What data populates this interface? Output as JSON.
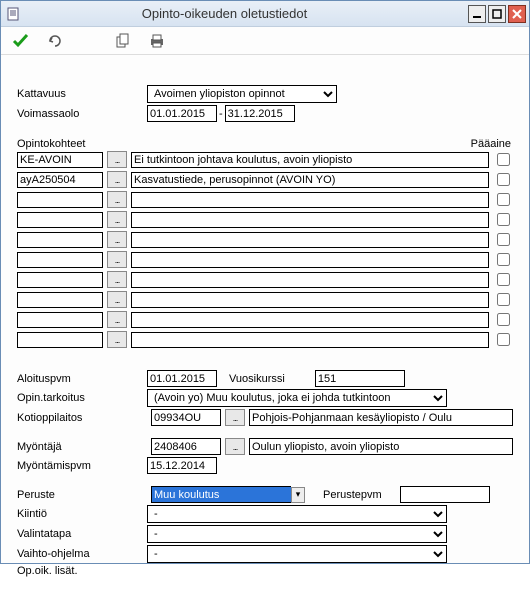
{
  "window": {
    "title": "Opinto-oikeuden oletustiedot"
  },
  "labels": {
    "kattavuus": "Kattavuus",
    "voimassaolo": "Voimassaolo",
    "opintokohteet": "Opintokohteet",
    "paaaine": "Pääaine",
    "aloituspvm": "Aloituspvm",
    "vuosikurssi": "Vuosikurssi",
    "opin_tarkoitus": "Opin.tarkoitus",
    "kotioppilaitos": "Kotioppilaitos",
    "myontaja": "Myöntäjä",
    "myontamispvm": "Myöntämispvm",
    "peruste": "Peruste",
    "perustepvm": "Perustepvm",
    "kiintio": "Kiintiö",
    "valintatapa": "Valintatapa",
    "vaihto_ohjelma": "Vaihto-ohjelma",
    "op_oik_lisat": "Op.oik. lisät."
  },
  "values": {
    "kattavuus": "Avoimen yliopiston opinnot",
    "voimassa_alku": "01.01.2015",
    "voimassa_loppu": "31.12.2015",
    "aloituspvm": "01.01.2015",
    "vuosikurssi": "151",
    "opin_tarkoitus": "(Avoin yo) Muu koulutus, joka ei johda tutkintoon",
    "kotioppilaitos_code": "09934OU",
    "kotioppilaitos_name": "Pohjois-Pohjanmaan kesäyliopisto / Oulu",
    "myontaja_code": "2408406",
    "myontaja_name": "Oulun yliopisto, avoin yliopisto",
    "myontamispvm": "15.12.2014",
    "peruste": "Muu koulutus",
    "perustepvm": "",
    "kiintio": "-",
    "valintatapa": "-",
    "vaihto_ohjelma": "-"
  },
  "opintokohteet": [
    {
      "code": "KE-AVOIN",
      "desc": "Ei tutkintoon johtava koulutus, avoin yliopisto"
    },
    {
      "code": "ayA250504",
      "desc": "Kasvatustiede, perusopinnot (AVOIN YO)"
    },
    {
      "code": "",
      "desc": ""
    },
    {
      "code": "",
      "desc": ""
    },
    {
      "code": "",
      "desc": ""
    },
    {
      "code": "",
      "desc": ""
    },
    {
      "code": "",
      "desc": ""
    },
    {
      "code": "",
      "desc": ""
    },
    {
      "code": "",
      "desc": ""
    },
    {
      "code": "",
      "desc": ""
    }
  ],
  "icon_glyphs": {
    "ellipsis": "..."
  }
}
